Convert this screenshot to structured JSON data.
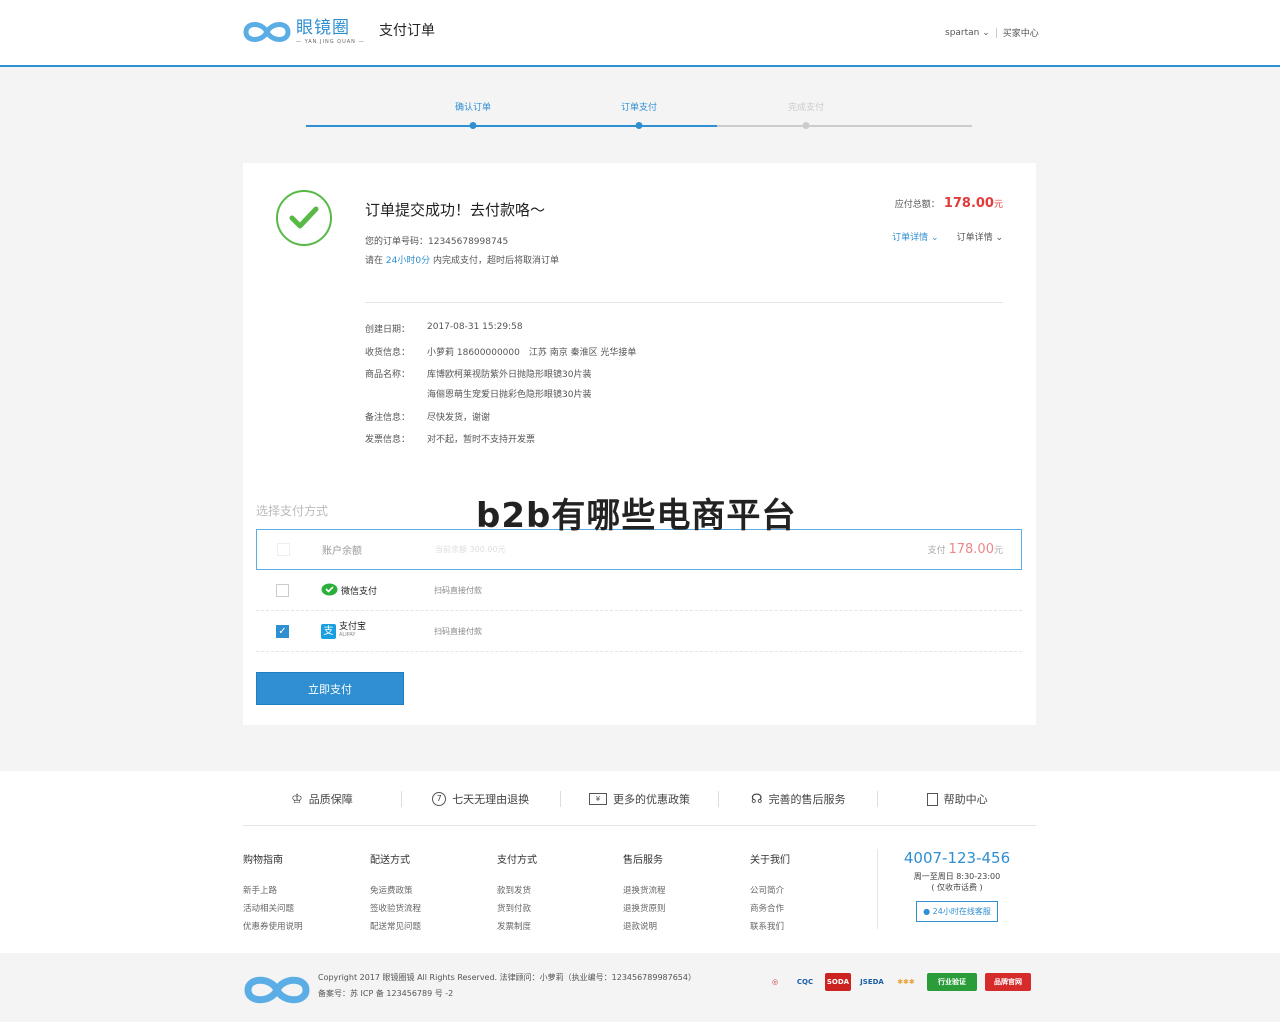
{
  "header": {
    "logo_cn": "眼镜圈",
    "logo_en": "— YAN JING QUAN —",
    "page_title": "支付订单",
    "user_name": "spartan",
    "buyer_center": "买家中心"
  },
  "steps": [
    {
      "label": "确认订单",
      "state": "done"
    },
    {
      "label": "订单支付",
      "state": "active"
    },
    {
      "label": "完成支付",
      "state": "todo"
    }
  ],
  "colors": {
    "accent": "#2f8fd1",
    "success": "#58b947",
    "price": "#e23b3b"
  },
  "order": {
    "title": "订单提交成功！去付款咯～",
    "number_label": "您的订单号码：12345678998745",
    "deadline_prefix": "请在",
    "deadline_time": "24小时0分",
    "deadline_suffix": "内完成支付，超时后将取消订单",
    "total_label": "应付总额：",
    "total_amount": "178.00",
    "total_unit": "元",
    "detail_link_1": "订单详情",
    "detail_link_2": "订单详情",
    "info": [
      {
        "key": "创建日期：",
        "value": "2017-08-31 15:29:58"
      },
      {
        "key": "收货信息：",
        "value": "小萝莉 18600000000　江苏 南京 秦淮区 光华接单"
      },
      {
        "key": "商品名称：",
        "value": "库博欧柯莱视防紫外日抛隐形眼镜30片装"
      },
      {
        "key": "",
        "value": "海俪恩萌生宠爱日抛彩色隐形眼镜30片装"
      },
      {
        "key": "备注信息：",
        "value": "尽快发货，谢谢"
      },
      {
        "key": "发票信息：",
        "value": "对不起，暂时不支持开发票"
      }
    ]
  },
  "payment": {
    "section_title": "选择支付方式",
    "watermark": "b2b有哪些电商平台",
    "balance": {
      "name": "账户余额",
      "desc": "当前余额 300.00元",
      "pay_label": "支付",
      "pay_amount": "178.00",
      "pay_unit": "元"
    },
    "wechat": {
      "name": "微信支付",
      "desc": "扫码直接付款"
    },
    "alipay": {
      "name": "支付宝",
      "sub": "ALIPAY",
      "desc": "扫码直接付款"
    },
    "checkmark": "✓",
    "button": "立即支付"
  },
  "footer": {
    "promises": [
      {
        "label": "品质保障",
        "icon": "crown-icon"
      },
      {
        "label": "七天无理由退换",
        "icon": "seven-icon"
      },
      {
        "label": "更多的优惠政策",
        "icon": "ticket-icon"
      },
      {
        "label": "完善的售后服务",
        "icon": "headset-icon"
      },
      {
        "label": "帮助中心",
        "icon": "book-icon"
      }
    ],
    "columns": [
      {
        "title": "购物指南",
        "items": [
          "新手上路",
          "活动相关问题",
          "优惠券使用说明"
        ]
      },
      {
        "title": "配送方式",
        "items": [
          "免运费政策",
          "签收验货流程",
          "配送常见问题"
        ]
      },
      {
        "title": "支付方式",
        "items": [
          "款到发货",
          "货到付款",
          "发票制度"
        ]
      },
      {
        "title": "售后服务",
        "items": [
          "退换货流程",
          "退换货原则",
          "退款说明"
        ]
      },
      {
        "title": "关于我们",
        "items": [
          "公司简介",
          "商务合作",
          "联系我们"
        ]
      }
    ],
    "hotline": "4007-123-456",
    "hours_1": "周一至周日 8:30-23:00",
    "hours_2": "( 仅收市话费 )",
    "online_service": "24小时在线客服",
    "copyright": "Copyright 2017 眼镜圈镜 All Rights Reserved. 法律顾问：小萝莉（执业编号：123456789987654）",
    "icp": "备案号：苏 ICP 备 123456789 号 -2",
    "badges": [
      "CQC",
      "SODA",
      "JSEDA",
      "行业验证",
      "品牌官网"
    ]
  }
}
